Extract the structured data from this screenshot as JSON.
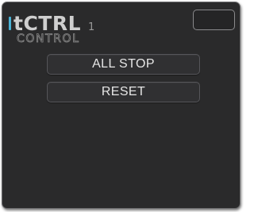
{
  "logo": {
    "main": "tCTRL",
    "number": "1",
    "sub": "CONTROL"
  },
  "buttons": {
    "all_stop": "ALL STOP",
    "reset": "RESET"
  },
  "colors": {
    "panel_bg": "#2a2a2b",
    "accent": "#4ab3d6",
    "button_text": "#e6e6e6"
  }
}
